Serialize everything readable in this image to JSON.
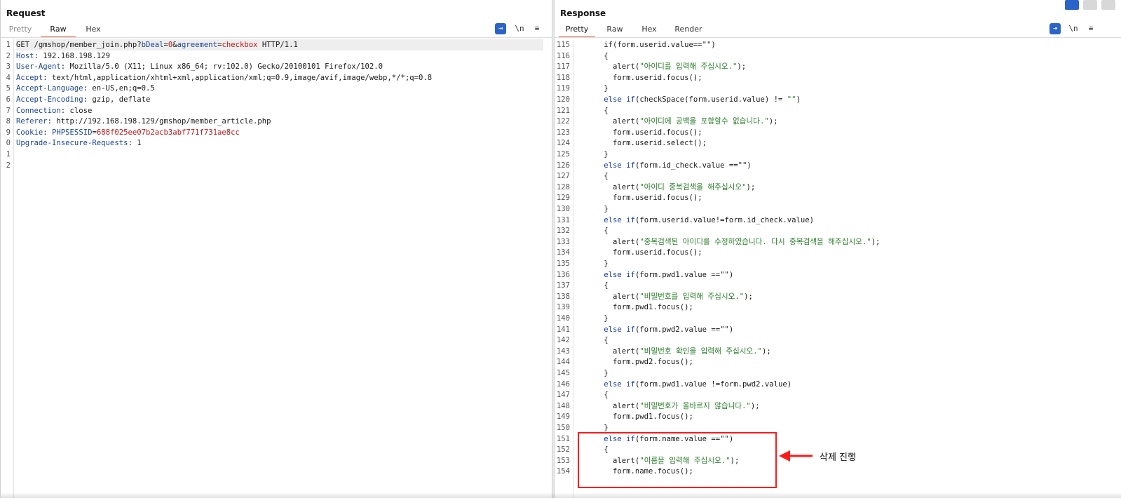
{
  "request": {
    "title": "Request",
    "tabs": [
      "Pretty",
      "Raw",
      "Hex"
    ],
    "active_tab": "Raw",
    "tools": {
      "wrap_icon": "wrap-lines-icon",
      "newline_label": "\\n",
      "menu_icon": "hamburger-menu-icon"
    },
    "lines": [
      {
        "n": "1",
        "parts": [
          [
            "v",
            "GET /gmshop/member_join.php?"
          ],
          [
            "p",
            "bDeal"
          ],
          [
            "v",
            "="
          ],
          [
            "pv",
            "0"
          ],
          [
            "v",
            "&"
          ],
          [
            "p",
            "agreement"
          ],
          [
            "v",
            "="
          ],
          [
            "pv",
            "checkbox"
          ],
          [
            "v",
            " HTTP/1.1"
          ]
        ]
      },
      {
        "n": "2",
        "parts": [
          [
            "k",
            "Host"
          ],
          [
            "v",
            ": 192.168.198.129"
          ]
        ]
      },
      {
        "n": "3",
        "parts": [
          [
            "k",
            "User-Agent"
          ],
          [
            "v",
            ": Mozilla/5.0 (X11; Linux x86_64; rv:102.0) Gecko/20100101 Firefox/102.0"
          ]
        ]
      },
      {
        "n": "4",
        "parts": [
          [
            "k",
            "Accept"
          ],
          [
            "v",
            ": text/html,application/xhtml+xml,application/xml;q=0.9,image/avif,image/webp,*/*;q=0.8"
          ]
        ]
      },
      {
        "n": "5",
        "parts": [
          [
            "k",
            "Accept-Language"
          ],
          [
            "v",
            ": en-US,en;q=0.5"
          ]
        ]
      },
      {
        "n": "6",
        "parts": [
          [
            "k",
            "Accept-Encoding"
          ],
          [
            "v",
            ": gzip, deflate"
          ]
        ]
      },
      {
        "n": "7",
        "parts": [
          [
            "k",
            "Connection"
          ],
          [
            "v",
            ": close"
          ]
        ]
      },
      {
        "n": "8",
        "parts": [
          [
            "k",
            "Referer"
          ],
          [
            "v",
            ": http://192.168.198.129/gmshop/member_article.php"
          ]
        ]
      },
      {
        "n": "9",
        "parts": [
          [
            "k",
            "Cookie"
          ],
          [
            "v",
            ": "
          ],
          [
            "p",
            "PHPSESSID"
          ],
          [
            "v",
            "="
          ],
          [
            "pv",
            "688f025ee07b2acb3abf771f731ae8cc"
          ]
        ]
      },
      {
        "n": "0",
        "parts": [
          [
            "k",
            "Upgrade-Insecure-Requests"
          ],
          [
            "v",
            ": 1"
          ]
        ]
      },
      {
        "n": "1",
        "parts": []
      },
      {
        "n": "2",
        "parts": []
      }
    ]
  },
  "response": {
    "title": "Response",
    "tabs": [
      "Pretty",
      "Raw",
      "Hex",
      "Render"
    ],
    "active_tab": "Pretty",
    "tools": {
      "wrap_icon": "wrap-lines-icon",
      "newline_label": "\\n",
      "menu_icon": "hamburger-menu-icon"
    },
    "lines": [
      {
        "n": "115",
        "parts": [
          [
            "v",
            "      if(form.userid.value==\"\")"
          ]
        ]
      },
      {
        "n": "116",
        "parts": [
          [
            "v",
            "      {"
          ]
        ]
      },
      {
        "n": "117",
        "parts": [
          [
            "v",
            "        alert("
          ],
          [
            "s",
            "\"아이디를 입력해 주십시오.\""
          ],
          [
            "v",
            ");"
          ]
        ]
      },
      {
        "n": "118",
        "parts": [
          [
            "v",
            "        form.userid.focus();"
          ]
        ]
      },
      {
        "n": "119",
        "parts": [
          [
            "v",
            "      }"
          ]
        ]
      },
      {
        "n": "120",
        "parts": [
          [
            "v",
            "      "
          ],
          [
            "kw",
            "else if"
          ],
          [
            "v",
            "(checkSpace(form.userid.value) != "
          ],
          [
            "s",
            "\"\""
          ],
          [
            "v",
            ")"
          ]
        ]
      },
      {
        "n": "121",
        "parts": [
          [
            "v",
            "      {"
          ]
        ]
      },
      {
        "n": "122",
        "parts": [
          [
            "v",
            "        alert("
          ],
          [
            "s",
            "\"아이디에 공백을 포함할수 없습니다.\""
          ],
          [
            "v",
            ");"
          ]
        ]
      },
      {
        "n": "123",
        "parts": [
          [
            "v",
            "        form.userid.focus();"
          ]
        ]
      },
      {
        "n": "124",
        "parts": [
          [
            "v",
            "        form.userid.select();"
          ]
        ]
      },
      {
        "n": "125",
        "parts": [
          [
            "v",
            "      }"
          ]
        ]
      },
      {
        "n": "126",
        "parts": [
          [
            "v",
            "      "
          ],
          [
            "kw",
            "else if"
          ],
          [
            "v",
            "(form.id_check.value ==\"\")"
          ]
        ]
      },
      {
        "n": "127",
        "parts": [
          [
            "v",
            "      {"
          ]
        ]
      },
      {
        "n": "128",
        "parts": [
          [
            "v",
            "        alert("
          ],
          [
            "s",
            "\"아이디 중복검색을 해주십시오\""
          ],
          [
            "v",
            ");"
          ]
        ]
      },
      {
        "n": "129",
        "parts": [
          [
            "v",
            "        form.userid.focus();"
          ]
        ]
      },
      {
        "n": "130",
        "parts": [
          [
            "v",
            "      }"
          ]
        ]
      },
      {
        "n": "131",
        "parts": [
          [
            "v",
            "      "
          ],
          [
            "kw",
            "else if"
          ],
          [
            "v",
            "(form.userid.value!=form.id_check.value)"
          ]
        ]
      },
      {
        "n": "132",
        "parts": [
          [
            "v",
            "      {"
          ]
        ]
      },
      {
        "n": "133",
        "parts": [
          [
            "v",
            "        alert("
          ],
          [
            "s",
            "\"중복검색된 아이디를 수정하였습니다. 다시 중복검색을 해주십시오.\""
          ],
          [
            "v",
            ");"
          ]
        ]
      },
      {
        "n": "134",
        "parts": [
          [
            "v",
            "        form.userid.focus();"
          ]
        ]
      },
      {
        "n": "135",
        "parts": [
          [
            "v",
            "      }"
          ]
        ]
      },
      {
        "n": "136",
        "parts": [
          [
            "v",
            "      "
          ],
          [
            "kw",
            "else if"
          ],
          [
            "v",
            "(form.pwd1.value ==\"\")"
          ]
        ]
      },
      {
        "n": "137",
        "parts": [
          [
            "v",
            "      {"
          ]
        ]
      },
      {
        "n": "138",
        "parts": [
          [
            "v",
            "        alert("
          ],
          [
            "s",
            "\"비밀번호를 입력해 주십시오.\""
          ],
          [
            "v",
            ");"
          ]
        ]
      },
      {
        "n": "139",
        "parts": [
          [
            "v",
            "        form.pwd1.focus();"
          ]
        ]
      },
      {
        "n": "140",
        "parts": [
          [
            "v",
            "      }"
          ]
        ]
      },
      {
        "n": "141",
        "parts": [
          [
            "v",
            "      "
          ],
          [
            "kw",
            "else if"
          ],
          [
            "v",
            "(form.pwd2.value ==\"\")"
          ]
        ]
      },
      {
        "n": "142",
        "parts": [
          [
            "v",
            "      {"
          ]
        ]
      },
      {
        "n": "143",
        "parts": [
          [
            "v",
            "        alert("
          ],
          [
            "s",
            "\"비밀번호 확인을 입력해 주십시오.\""
          ],
          [
            "v",
            ");"
          ]
        ]
      },
      {
        "n": "144",
        "parts": [
          [
            "v",
            "        form.pwd2.focus();"
          ]
        ]
      },
      {
        "n": "145",
        "parts": [
          [
            "v",
            "      }"
          ]
        ]
      },
      {
        "n": "146",
        "parts": [
          [
            "v",
            "      "
          ],
          [
            "kw",
            "else if"
          ],
          [
            "v",
            "(form.pwd1.value !=form.pwd2.value)"
          ]
        ]
      },
      {
        "n": "147",
        "parts": [
          [
            "v",
            "      {"
          ]
        ]
      },
      {
        "n": "148",
        "parts": [
          [
            "v",
            "        alert("
          ],
          [
            "s",
            "\"비밀번호가 올바르지 않습니다.\""
          ],
          [
            "v",
            ");"
          ]
        ]
      },
      {
        "n": "149",
        "parts": [
          [
            "v",
            "        form.pwd1.focus();"
          ]
        ]
      },
      {
        "n": "150",
        "parts": [
          [
            "v",
            "      }"
          ]
        ]
      },
      {
        "n": "151",
        "parts": [
          [
            "v",
            "      "
          ],
          [
            "kw",
            "else if"
          ],
          [
            "v",
            "(form.name.value ==\"\")"
          ]
        ]
      },
      {
        "n": "152",
        "parts": [
          [
            "v",
            "      {"
          ]
        ]
      },
      {
        "n": "153",
        "parts": [
          [
            "v",
            "        alert("
          ],
          [
            "s",
            "\"이름을 입력해 주십시오.\""
          ],
          [
            "v",
            ");"
          ]
        ]
      },
      {
        "n": "154",
        "parts": [
          [
            "v",
            "        form.name.focus();"
          ]
        ]
      }
    ]
  },
  "annotation": {
    "label": "삭제 진행",
    "color": "#ff1a1a"
  },
  "colors": {
    "accent_tab": "#e8633a",
    "wrap_button": "#2b63c9",
    "key": "#1a4496",
    "param_value": "#c11818",
    "string": "#2a7d2a"
  }
}
